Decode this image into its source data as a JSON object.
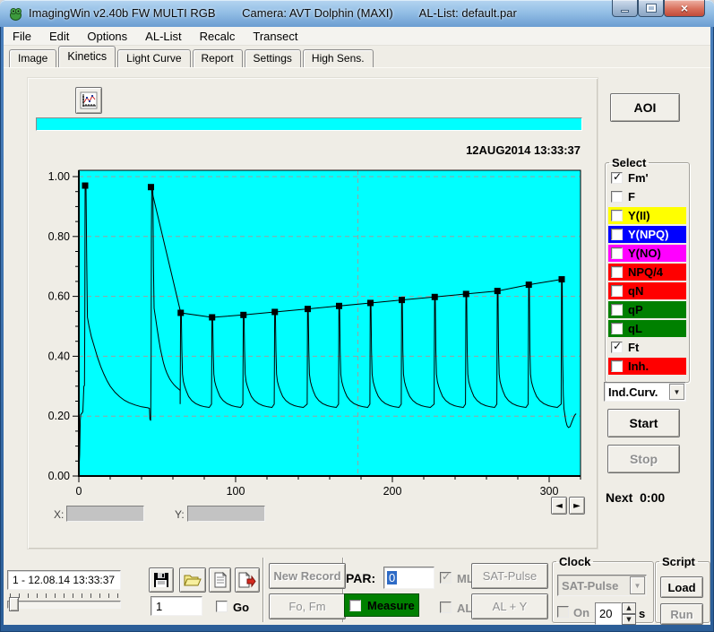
{
  "window": {
    "app_title": "ImagingWin v2.40b  FW MULTI RGB",
    "camera": "Camera: AVT Dolphin (MAXI)",
    "al_list": "AL-List: default.par"
  },
  "menu": {
    "items": [
      "File",
      "Edit",
      "Options",
      "AL-List",
      "Recalc",
      "Transect"
    ]
  },
  "tabs": {
    "items": [
      "Image",
      "Kinetics",
      "Light Curve",
      "Report",
      "Settings",
      "High Sens."
    ],
    "active_index": 1
  },
  "toolbar": {
    "aoi_label": "AOI",
    "progress_color": "#00ffff"
  },
  "chart_data": {
    "type": "line",
    "annotation": "12AUG2014  13:33:37",
    "background": "#00ffff",
    "xlim": [
      0,
      320
    ],
    "ylim": [
      0,
      1.021
    ],
    "x_major_ticks": [
      0,
      100,
      200,
      300
    ],
    "x_minor_step": 20,
    "y_major_ticks": [
      0.0,
      0.2,
      0.4,
      0.6,
      0.8,
      1.0
    ],
    "y_minor_step": 0.05,
    "grid": {
      "y_dashed_at": [
        0.2,
        0.4,
        0.6,
        0.8,
        1.0
      ],
      "x_dashed_at": [
        178
      ],
      "color": "#9aa0a0"
    },
    "series": [
      {
        "name": "Fm'",
        "style": "line+square-markers",
        "color": "#000000",
        "connect_from_index": 1,
        "points": [
          [
            4,
            0.97
          ],
          [
            46,
            0.965
          ],
          [
            65,
            0.545
          ],
          [
            85,
            0.53
          ],
          [
            105,
            0.538
          ],
          [
            125,
            0.548
          ],
          [
            146,
            0.558
          ],
          [
            166,
            0.568
          ],
          [
            186,
            0.578
          ],
          [
            206,
            0.588
          ],
          [
            227,
            0.598
          ],
          [
            247,
            0.608
          ],
          [
            267,
            0.618
          ],
          [
            287,
            0.639
          ],
          [
            308,
            0.657
          ]
        ]
      },
      {
        "name": "Ft",
        "style": "line",
        "color": "#000000",
        "head": [
          [
            0,
            0.01
          ],
          [
            0.5,
            0.07
          ],
          [
            0.9,
            0.185
          ],
          [
            1.2,
            0.205
          ],
          [
            2,
            0.21
          ],
          [
            2.6,
            0.215
          ],
          [
            2.9,
            0.26
          ],
          [
            3.2,
            0.3
          ],
          [
            3.6,
            0.302
          ],
          [
            3.8,
            0.55
          ],
          [
            4,
            0.97
          ],
          [
            4.6,
            0.97
          ],
          [
            5,
            0.72
          ],
          [
            5.4,
            0.55
          ],
          [
            5.5,
            0.53
          ],
          [
            6.5,
            0.5
          ],
          [
            8,
            0.465
          ],
          [
            10,
            0.43
          ],
          [
            12,
            0.395
          ],
          [
            14,
            0.365
          ],
          [
            16,
            0.34
          ],
          [
            18,
            0.318
          ],
          [
            20,
            0.3
          ],
          [
            23,
            0.28
          ],
          [
            26,
            0.265
          ],
          [
            29,
            0.253
          ],
          [
            32,
            0.245
          ],
          [
            36,
            0.237
          ],
          [
            40,
            0.231
          ],
          [
            44,
            0.228
          ],
          [
            45,
            0.226
          ],
          [
            45.3,
            0.19
          ],
          [
            45.8,
            0.185
          ],
          [
            46.1,
            0.4
          ],
          [
            46.3,
            0.81
          ],
          [
            46.5,
            0.965
          ],
          [
            47.2,
            0.965
          ],
          [
            47.6,
            0.7
          ],
          [
            48,
            0.56
          ],
          [
            49,
            0.525
          ],
          [
            50,
            0.49
          ],
          [
            51,
            0.455
          ],
          [
            52,
            0.425
          ],
          [
            53,
            0.4
          ],
          [
            54,
            0.378
          ],
          [
            55,
            0.36
          ],
          [
            56,
            0.346
          ],
          [
            57,
            0.334
          ],
          [
            58,
            0.324
          ],
          [
            59,
            0.316
          ],
          [
            60.5,
            0.306
          ],
          [
            62,
            0.298
          ],
          [
            63.5,
            0.291
          ],
          [
            64.6,
            0.286
          ]
        ],
        "pulse_xs": [
          65,
          85,
          105,
          125,
          146,
          166,
          186,
          206,
          227,
          247,
          267,
          287,
          308
        ],
        "pulse_peaks": [
          0.545,
          0.53,
          0.538,
          0.548,
          0.558,
          0.568,
          0.578,
          0.588,
          0.598,
          0.608,
          0.618,
          0.639,
          0.657
        ],
        "pulse_profile_dx": [
          -0.35,
          -0.1,
          0.35,
          0.7,
          1.1,
          1.7,
          2.5,
          3.6,
          5,
          7,
          9.5,
          12.5,
          15.5,
          18.2
        ],
        "pulse_profile_y": [
          0.24,
          "peak",
          "peak",
          0.42,
          0.34,
          0.316,
          0.3,
          0.283,
          0.266,
          0.252,
          0.242,
          0.235,
          0.231,
          0.229
        ],
        "baseline": 0.23,
        "tail": [
          [
            308.6,
            0.4
          ],
          [
            309,
            0.27
          ],
          [
            309.4,
            0.225
          ],
          [
            310,
            0.205
          ],
          [
            310.6,
            0.185
          ],
          [
            311.4,
            0.168
          ],
          [
            312.3,
            0.162
          ],
          [
            313.3,
            0.165
          ],
          [
            314.3,
            0.178
          ],
          [
            315.3,
            0.192
          ],
          [
            316.3,
            0.203
          ],
          [
            317.2,
            0.208
          ]
        ]
      }
    ]
  },
  "cursor_readout": {
    "x_label": "X:",
    "y_label": "Y:",
    "x_value": "",
    "y_value": ""
  },
  "nav_arrows": {
    "prev": "◄",
    "next": "►"
  },
  "select_panel": {
    "title": "Select",
    "items": [
      {
        "label": "Fm'",
        "checked": true,
        "bg": "",
        "fg": "#000000"
      },
      {
        "label": "F",
        "checked": false,
        "bg": "",
        "fg": "#000000"
      },
      {
        "label": "Y(II)",
        "checked": false,
        "bg": "#ffff00",
        "fg": "#000000"
      },
      {
        "label": "Y(NPQ)",
        "checked": false,
        "bg": "#0000ff",
        "fg": "#ffffff"
      },
      {
        "label": "Y(NO)",
        "checked": false,
        "bg": "#ff00ff",
        "fg": "#000000"
      },
      {
        "label": "NPQ/4",
        "checked": false,
        "bg": "#ff0000",
        "fg": "#000000"
      },
      {
        "label": "qN",
        "checked": false,
        "bg": "#ff0000",
        "fg": "#000000"
      },
      {
        "label": "qP",
        "checked": false,
        "bg": "#008000",
        "fg": "#000000"
      },
      {
        "label": "qL",
        "checked": false,
        "bg": "#008000",
        "fg": "#000000"
      },
      {
        "label": "Ft",
        "checked": true,
        "bg": "",
        "fg": "#000000"
      },
      {
        "label": "Inh.",
        "checked": false,
        "bg": "#ff0000",
        "fg": "#000000"
      }
    ]
  },
  "curve_selector": {
    "value": "Ind.Curv."
  },
  "run_controls": {
    "start_label": "Start",
    "stop_label": "Stop",
    "next_label": "Next",
    "next_value": "0:00"
  },
  "record_bar": {
    "record_field": "1 - 12.08.14 13:33:37",
    "record_number": "1",
    "go_label": "Go"
  },
  "measure_bar": {
    "new_record_label": "New Record",
    "fo_fm_label": "Fo, Fm",
    "par_label": "PAR:",
    "par_value": "0",
    "ml_label": "ML",
    "sat_pulse_label": "SAT-Pulse",
    "measure_label": "Measure",
    "al_label": "AL",
    "al_y_label": "AL + Y"
  },
  "clock_group": {
    "title": "Clock",
    "mode_value": "SAT-Pulse",
    "on_label": "On",
    "interval_value": "20",
    "interval_unit": "s"
  },
  "script_group": {
    "title": "Script",
    "load_label": "Load",
    "run_label": "Run"
  }
}
